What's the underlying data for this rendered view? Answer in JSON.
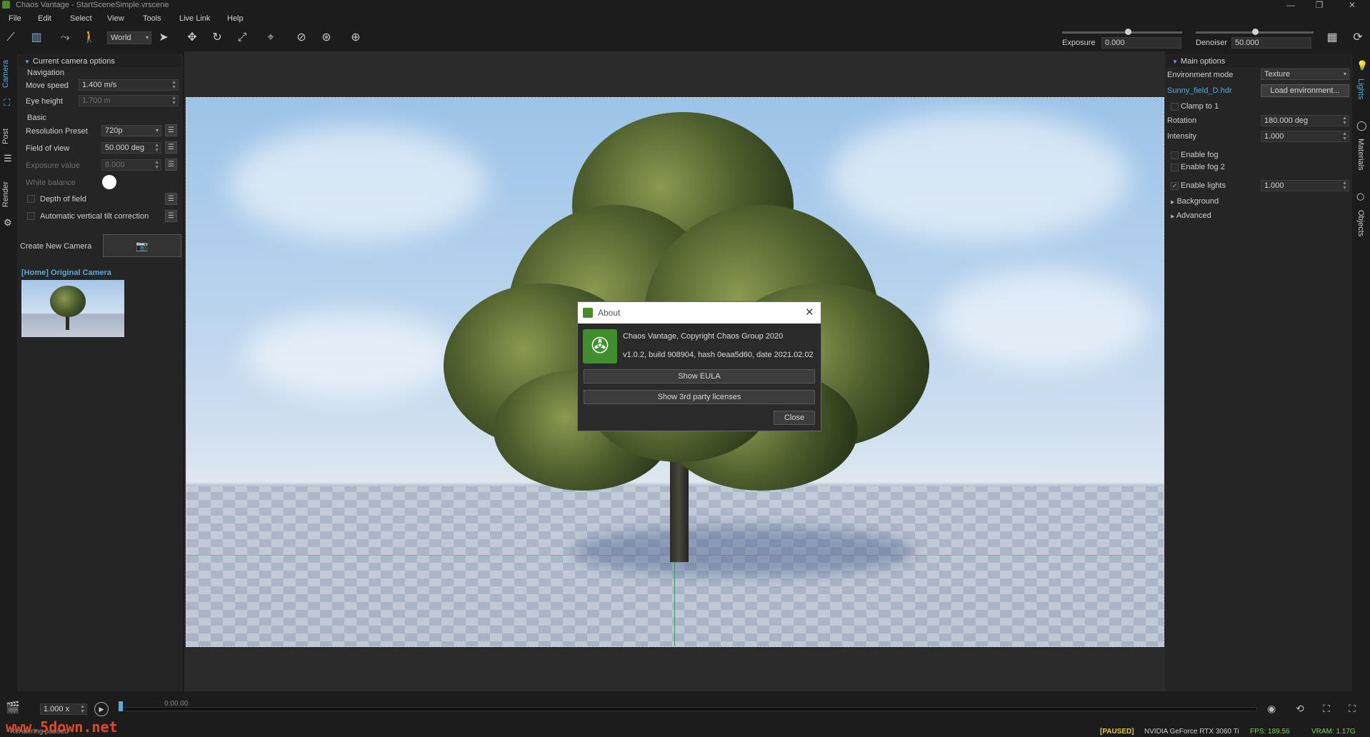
{
  "window": {
    "title": "Chaos Vantage - StartSceneSimple.vrscene"
  },
  "menu": [
    "File",
    "Edit",
    "Select",
    "View",
    "Tools",
    "Live Link",
    "Help"
  ],
  "toolbar": {
    "space_select": "World",
    "exposure_label": "Exposure",
    "exposure_value": "0.000",
    "exposure_level": 0.55,
    "denoiser_label": "Denoiser",
    "denoiser_value": "50.000",
    "denoiser_level": 0.5
  },
  "left_tabs": [
    "Camera",
    "Post",
    "Render"
  ],
  "camera_panel": {
    "header": "Current camera options",
    "navigation": {
      "title": "Navigation",
      "move_speed_label": "Move speed",
      "move_speed_value": "1.400 m/s",
      "eye_height_label": "Eye height",
      "eye_height_value": "1.700 m"
    },
    "basic": {
      "title": "Basic",
      "resolution_label": "Resolution Preset",
      "resolution_value": "720p",
      "fov_label": "Field of view",
      "fov_value": "50.000 deg",
      "exposure_label": "Exposure value",
      "exposure_value": "8.000",
      "white_balance_label": "White balance",
      "dof_label": "Depth of field",
      "tilt_label": "Automatic vertical tilt correction"
    },
    "create_camera_label": "Create New Camera",
    "camera_item_label": "[Home] Original Camera"
  },
  "about_dialog": {
    "title": "About",
    "line1": "Chaos Vantage, Copyright Chaos Group 2020",
    "line2": "v1.0.2, build 908904, hash 0eaa5d60, date 2021.02.02",
    "eula_button": "Show EULA",
    "licenses_button": "Show 3rd party licenses",
    "close_button": "Close"
  },
  "lights_panel": {
    "header": "Main options",
    "env_mode_label": "Environment mode",
    "env_mode_value": "Texture",
    "env_file": "Sunny_field_D.hdr",
    "load_env_button": "Load environment...",
    "clamp_label": "Clamp to 1",
    "rotation_label": "Rotation",
    "rotation_value": "180.000 deg",
    "intensity_label": "Intensity",
    "intensity_value": "1.000",
    "fog_label": "Enable fog",
    "fog2_label": "Enable fog 2",
    "lights_label": "Enable lights",
    "lights_value": "1.000",
    "background_label": "Background",
    "advanced_label": "Advanced"
  },
  "right_tabs": [
    "Lights",
    "Materials",
    "Objects"
  ],
  "timeline": {
    "speed": "1.000 x",
    "time": "0:00.00",
    "playhead_level": 0.0
  },
  "statusbar": {
    "left_text": "Rendering paused",
    "watermark": "www.5down.net",
    "paused": "[PAUSED]",
    "gpu": "NVIDIA GeForce RTX 3060 Ti",
    "fps": "FPS: 189.56",
    "vram": "VRAM:  1.17G"
  },
  "colors": {
    "accent": "#5aa9d6",
    "green": "#7bd15a",
    "watermark": "#e2492a",
    "paused": "#e6c84a"
  }
}
